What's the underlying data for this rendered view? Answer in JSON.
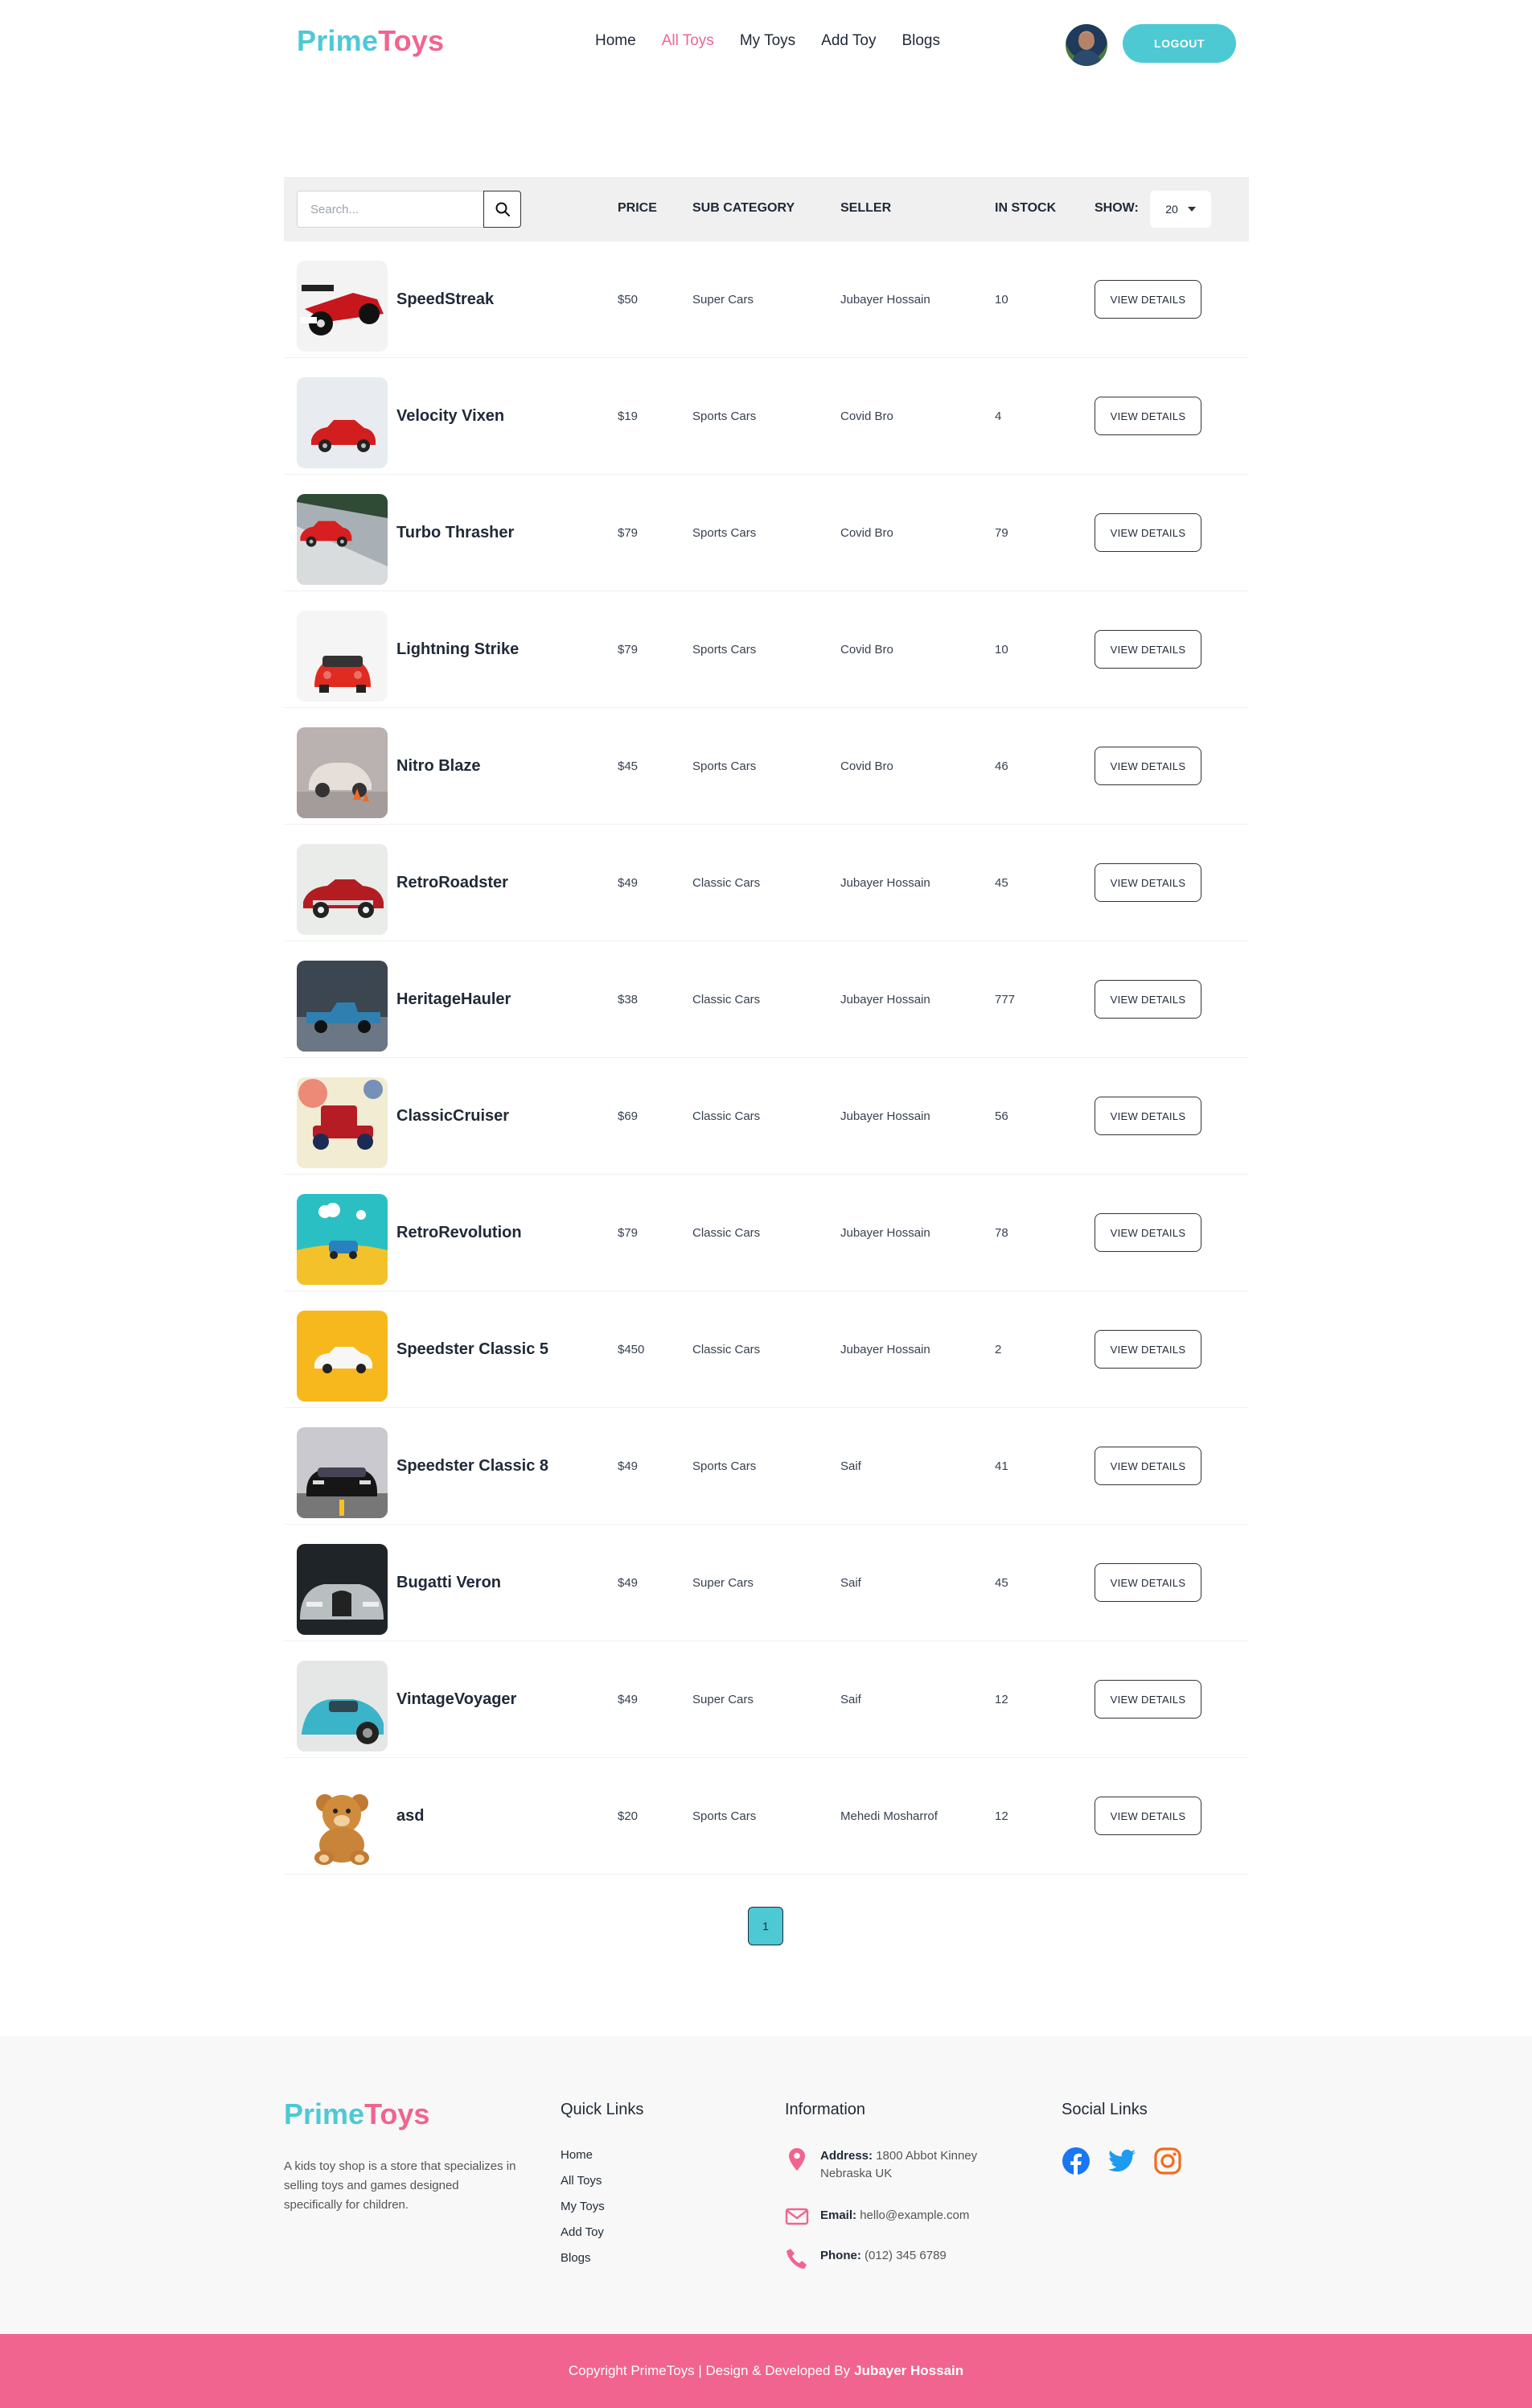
{
  "header": {
    "logo_prime": "Prime",
    "logo_toys": "Toys",
    "nav": [
      {
        "label": "Home",
        "active": false
      },
      {
        "label": "All Toys",
        "active": true
      },
      {
        "label": "My Toys",
        "active": false
      },
      {
        "label": "Add Toy",
        "active": false
      },
      {
        "label": "Blogs",
        "active": false
      }
    ],
    "logout_label": "LOGOUT"
  },
  "table": {
    "search_placeholder": "Search...",
    "columns": {
      "price": "PRICE",
      "sub_category": "SUB CATEGORY",
      "seller": "SELLER",
      "in_stock": "IN STOCK",
      "show": "SHOW:"
    },
    "show_value": "20",
    "details_label": "VIEW DETAILS",
    "rows": [
      {
        "name": "SpeedStreak",
        "price": "$50",
        "sub_category": "Super Cars",
        "seller": "Jubayer Hossain",
        "stock": "10",
        "thumb": "f1-red"
      },
      {
        "name": "Velocity Vixen",
        "price": "$19",
        "sub_category": "Sports Cars",
        "seller": "Covid Bro",
        "stock": "4",
        "thumb": "red-light"
      },
      {
        "name": "Turbo Thrasher",
        "price": "$79",
        "sub_category": "Sports Cars",
        "seller": "Covid Bro",
        "stock": "79",
        "thumb": "red-track"
      },
      {
        "name": "Lightning Strike",
        "price": "$79",
        "sub_category": "Sports Cars",
        "seller": "Covid Bro",
        "stock": "10",
        "thumb": "red-front"
      },
      {
        "name": "Nitro Blaze",
        "price": "$45",
        "sub_category": "Sports Cars",
        "seller": "Covid Bro",
        "stock": "46",
        "thumb": "porsche-grey"
      },
      {
        "name": "RetroRoadster",
        "price": "$49",
        "sub_category": "Classic Cars",
        "seller": "Jubayer Hossain",
        "stock": "45",
        "thumb": "classic-red"
      },
      {
        "name": "HeritageHauler",
        "price": "$38",
        "sub_category": "Classic Cars",
        "seller": "Jubayer Hossain",
        "stock": "777",
        "thumb": "blue-truck"
      },
      {
        "name": "ClassicCruiser",
        "price": "$69",
        "sub_category": "Classic Cars",
        "seller": "Jubayer Hossain",
        "stock": "56",
        "thumb": "vintage-red"
      },
      {
        "name": "RetroRevolution",
        "price": "$79",
        "sub_category": "Classic Cars",
        "seller": "Jubayer Hossain",
        "stock": "78",
        "thumb": "teal-yellow"
      },
      {
        "name": "Speedster Classic 5",
        "price": "$450",
        "sub_category": "Classic Cars",
        "seller": "Jubayer Hossain",
        "stock": "2",
        "thumb": "yellow-white"
      },
      {
        "name": "Speedster Classic 8",
        "price": "$49",
        "sub_category": "Sports Cars",
        "seller": "Saif",
        "stock": "41",
        "thumb": "mustang-black"
      },
      {
        "name": "Bugatti Veron",
        "price": "$49",
        "sub_category": "Super Cars",
        "seller": "Saif",
        "stock": "45",
        "thumb": "bugatti"
      },
      {
        "name": "VintageVoyager",
        "price": "$49",
        "sub_category": "Super Cars",
        "seller": "Saif",
        "stock": "12",
        "thumb": "teal-porsche"
      },
      {
        "name": "asd",
        "price": "$20",
        "sub_category": "Sports Cars",
        "seller": "Mehedi Mosharrof",
        "stock": "12",
        "thumb": "teddy-bear"
      }
    ]
  },
  "pagination": {
    "current": "1"
  },
  "footer": {
    "logo_prime": "Prime",
    "logo_toys": "Toys",
    "about": "A kids toy shop is a store that specializes in selling toys and games designed specifically for children.",
    "quick_links_title": "Quick Links",
    "quick_links": [
      "Home",
      "All Toys",
      "My Toys",
      "Add Toy",
      "Blogs"
    ],
    "information_title": "Information",
    "address_label": "Address:",
    "address_value": "1800 Abbot Kinney",
    "address_line2": "Nebraska UK",
    "email_label": "Email:",
    "email_value": "hello@example.com",
    "phone_label": "Phone:",
    "phone_value": "(012) 345 6789",
    "social_title": "Social Links",
    "social_icons": [
      "facebook-icon",
      "twitter-icon",
      "instagram-icon"
    ]
  },
  "copyright": {
    "text": "Copyright PrimeToys | Design & Developed By",
    "author": "Jubayer Hossain"
  },
  "colors": {
    "accent_teal": "#4dc9d4",
    "accent_pink": "#f1648f"
  }
}
